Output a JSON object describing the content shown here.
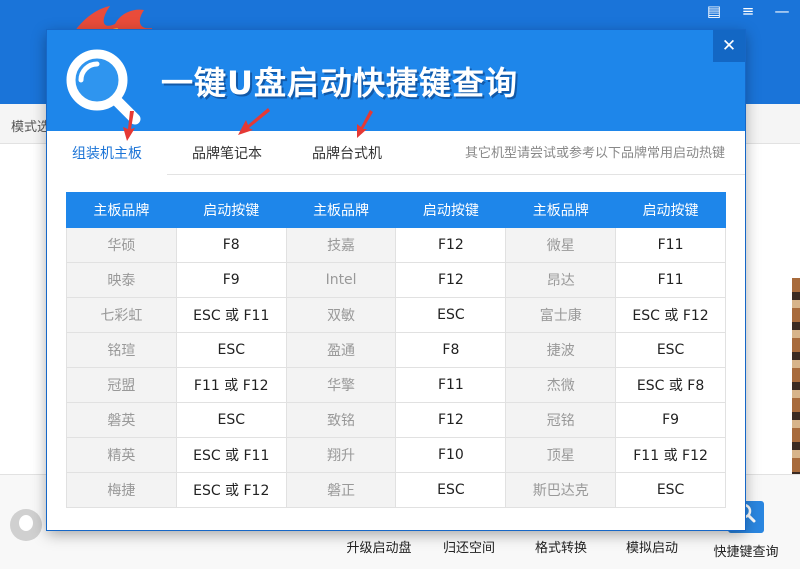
{
  "app": {
    "mode_label": "模式选",
    "footer_text": "                 ",
    "footer_buttons": [
      {
        "label": "升级启动盘"
      },
      {
        "label": "归还空间"
      },
      {
        "label": "格式转换"
      },
      {
        "label": "模拟启动"
      },
      {
        "label": "快捷键查询"
      }
    ],
    "window_controls": {
      "skin": "▤",
      "menu": "≡",
      "minimize": "—"
    }
  },
  "modal": {
    "title": "一键U盘启动快捷键查询",
    "close": "✕",
    "tabs": [
      {
        "label": "组装机主板",
        "active": true
      },
      {
        "label": "品牌笔记本",
        "active": false
      },
      {
        "label": "品牌台式机",
        "active": false
      }
    ],
    "tab_note": "其它机型请尝试或参考以下品牌常用启动热键",
    "table": {
      "headers": [
        "主板品牌",
        "启动按键",
        "主板品牌",
        "启动按键",
        "主板品牌",
        "启动按键"
      ],
      "rows": [
        [
          "华硕",
          "F8",
          "技嘉",
          "F12",
          "微星",
          "F11"
        ],
        [
          "映泰",
          "F9",
          "Intel",
          "F12",
          "昂达",
          "F11"
        ],
        [
          "七彩虹",
          "ESC 或 F11",
          "双敏",
          "ESC",
          "富士康",
          "ESC 或 F12"
        ],
        [
          "铭瑄",
          "ESC",
          "盈通",
          "F8",
          "捷波",
          "ESC"
        ],
        [
          "冠盟",
          "F11 或 F12",
          "华擎",
          "F11",
          "杰微",
          "ESC 或 F8"
        ],
        [
          "磐英",
          "ESC",
          "致铭",
          "F12",
          "冠铭",
          "F9"
        ],
        [
          "精英",
          "ESC 或 F11",
          "翔升",
          "F10",
          "顶星",
          "F11 或 F12"
        ],
        [
          "梅捷",
          "ESC 或 F12",
          "磐正",
          "ESC",
          "斯巴达克",
          "ESC"
        ]
      ]
    }
  },
  "colors": {
    "accent": "#1e86ea",
    "header_bg": "#1a74d9",
    "arrow": "#e53935"
  },
  "icons": {
    "title_icon": "magnifier-icon",
    "tab_arrow": "red-arrow-icon"
  }
}
